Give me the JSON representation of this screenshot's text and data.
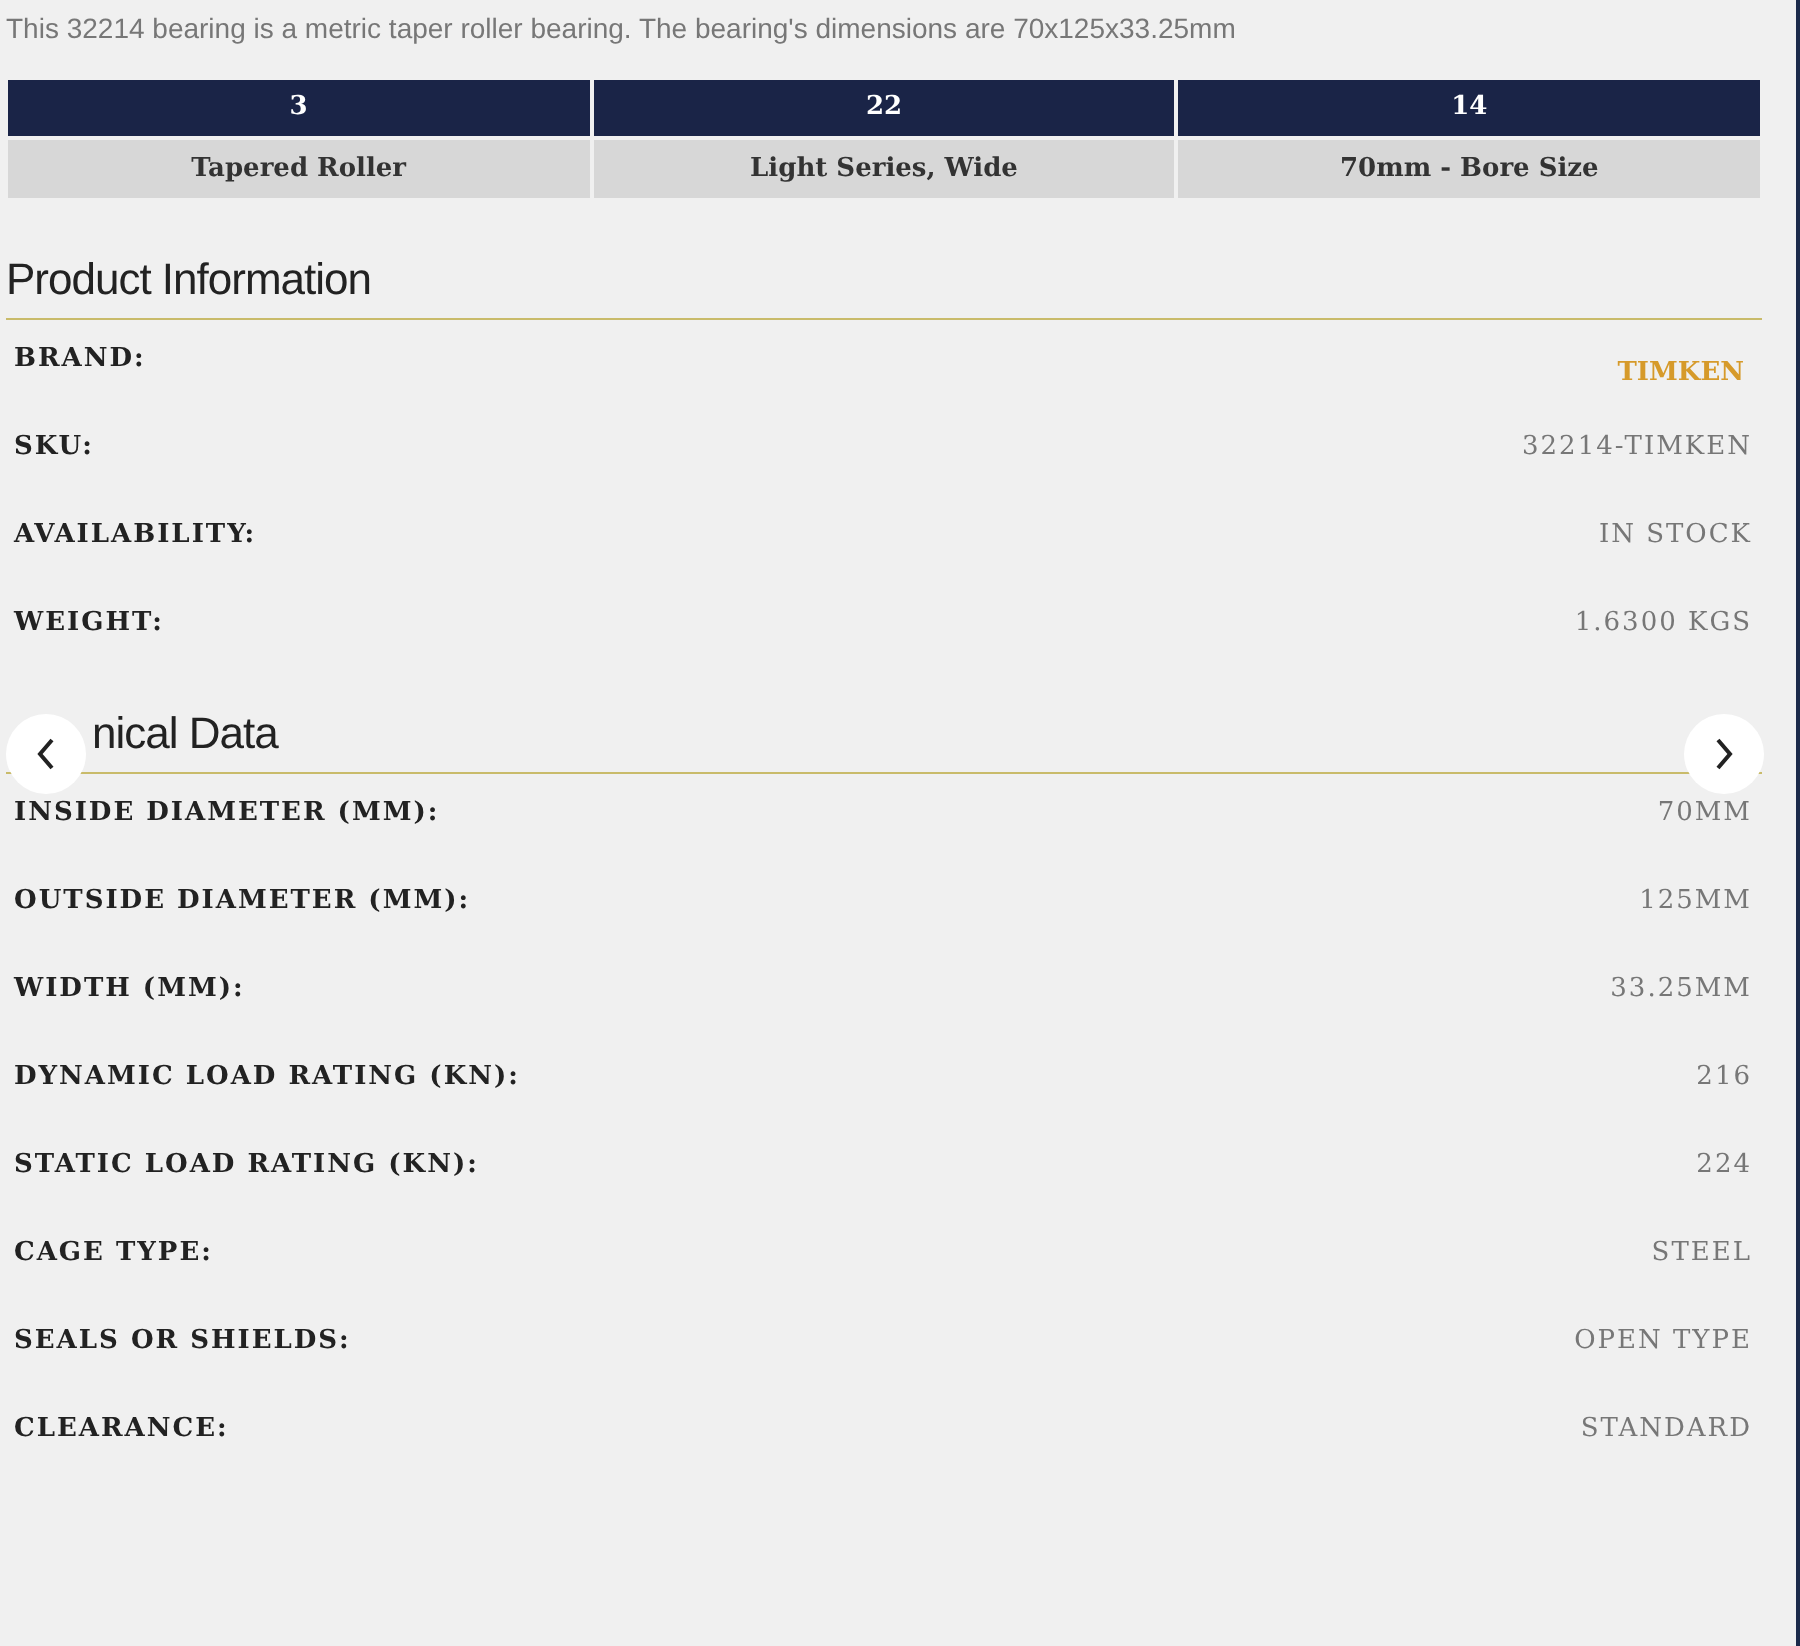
{
  "intro": "This 32214 bearing is a metric taper roller bearing. The bearing's dimensions are 70x125x33.25mm",
  "code_table": {
    "header": [
      "3",
      "22",
      "14"
    ],
    "row": [
      "Tapered Roller",
      "Light Series, Wide",
      "70mm - Bore Size"
    ]
  },
  "sections": [
    {
      "title": "Product Information",
      "rows": [
        {
          "label": "BRAND:",
          "value": "TIMKEN",
          "kind": "brand"
        },
        {
          "label": "SKU:",
          "value": "32214-TIMKEN",
          "kind": "plain"
        },
        {
          "label": "AVAILABILITY:",
          "value": "IN STOCK",
          "kind": "plain"
        },
        {
          "label": "WEIGHT:",
          "value": "1.6300 KGS",
          "kind": "plain"
        }
      ]
    },
    {
      "title": "nical Data",
      "rows": [
        {
          "label": "INSIDE DIAMETER (MM):",
          "value": "70MM",
          "kind": "plain"
        },
        {
          "label": "OUTSIDE DIAMETER (MM):",
          "value": "125MM",
          "kind": "plain"
        },
        {
          "label": "WIDTH (MM):",
          "value": "33.25MM",
          "kind": "plain"
        },
        {
          "label": "DYNAMIC LOAD RATING (KN):",
          "value": "216",
          "kind": "plain"
        },
        {
          "label": "STATIC LOAD RATING (KN):",
          "value": "224",
          "kind": "plain"
        },
        {
          "label": "CAGE TYPE:",
          "value": "STEEL",
          "kind": "plain"
        },
        {
          "label": "SEALS OR SHIELDS:",
          "value": "OPEN TYPE",
          "kind": "plain"
        },
        {
          "label": "CLEARANCE:",
          "value": "STANDARD",
          "kind": "plain"
        }
      ]
    }
  ]
}
